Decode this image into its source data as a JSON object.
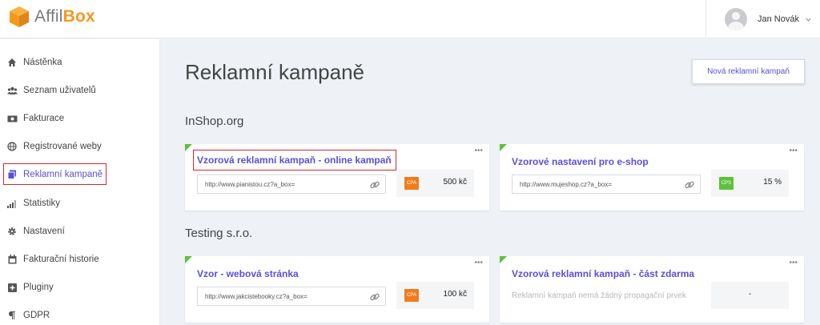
{
  "app": {
    "logo_part1": "Affil",
    "logo_part2": "Box",
    "accent_color": "#5a4fd6",
    "logo_color": "#f29a1d"
  },
  "user": {
    "name": "Jan Novák"
  },
  "sidebar": {
    "items": [
      {
        "label": "Nástěnka",
        "icon": "home-icon"
      },
      {
        "label": "Seznam uživatelů",
        "icon": "users-icon"
      },
      {
        "label": "Fakturace",
        "icon": "money-icon"
      },
      {
        "label": "Registrované weby",
        "icon": "globe-icon"
      },
      {
        "label": "Reklamní kampaně",
        "icon": "copy-icon",
        "active": true
      },
      {
        "label": "Statistiky",
        "icon": "signal-icon"
      },
      {
        "label": "Nastavení",
        "icon": "gear-icon"
      },
      {
        "label": "Fakturační historie",
        "icon": "calendar-icon"
      },
      {
        "label": "Pluginy",
        "icon": "plus-square-icon"
      },
      {
        "label": "GDPR",
        "icon": "paragraph-icon"
      }
    ]
  },
  "main": {
    "title": "Reklamní kampaně",
    "new_button": "Nová reklamní kampaň",
    "groups": [
      {
        "name": "InShop.org",
        "campaigns": [
          {
            "title": "Vzorová reklamní kampaň - online kampaň",
            "url": "http://www.pianistou.cz?a_box=",
            "type": "CPA",
            "value": "500 kč"
          },
          {
            "title": "Vzorové nastavení pro e-shop",
            "url": "http://www.mujeshop.cz?a_box=",
            "type": "CPS",
            "value": "15 %"
          }
        ]
      },
      {
        "name": "Testing s.r.o.",
        "campaigns": [
          {
            "title": "Vzor - webová stránka",
            "url": "http://www.jakcistebooky.cz?a_box=",
            "type": "CPA",
            "value": "100 kč"
          },
          {
            "title": "Vzorová reklamní kampaň - část zdarma",
            "no_promo": "Reklamní kampaň nemá žádný propagační prvek",
            "value": "-"
          }
        ]
      }
    ]
  }
}
